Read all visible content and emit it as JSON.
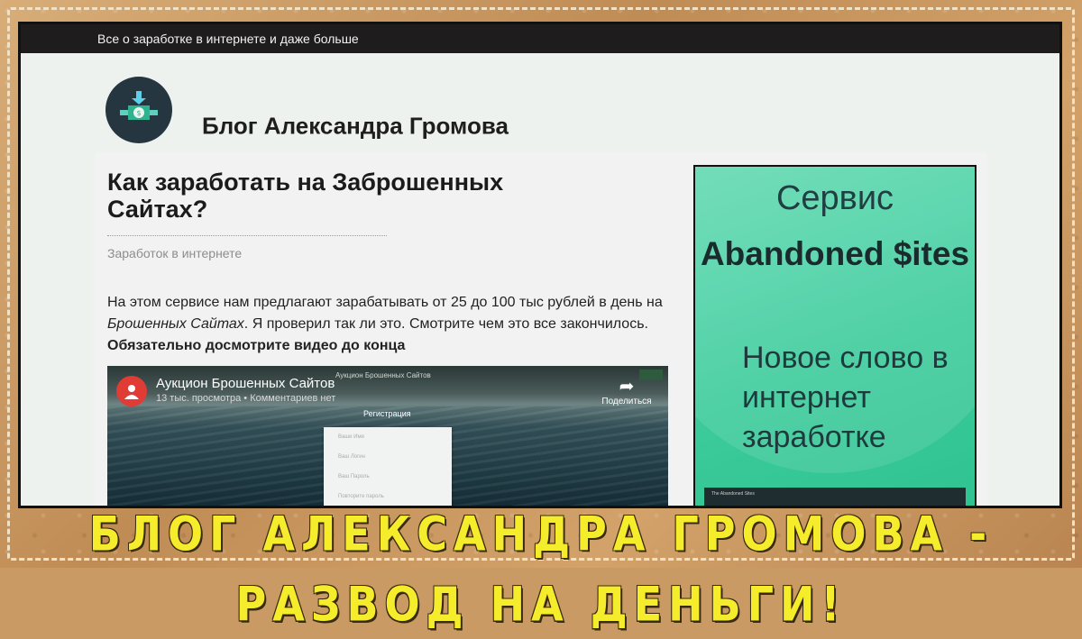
{
  "topbar": {
    "tagline": "Все о заработке в интернете и даже больше"
  },
  "header": {
    "site_title": "Блог Александра Громова",
    "logo_icon": "money-download-icon"
  },
  "article": {
    "title": "Как заработать на Заброшенных Сайтах?",
    "category": "Заработок в интернете",
    "text_part1": "На этом сервисе нам предлагают зарабатывать от 25 до 100 тыс рублей в день на ",
    "text_italic": "Брошенных Сайтах",
    "text_part2": ". Я проверил так ли это. Смотрите чем это все закончилось. ",
    "text_bold": "Обязательно досмотрите видео до конца"
  },
  "video": {
    "title": "Аукцион Брошенных Сайтов",
    "meta": "13 тыс. просмотра • Комментариев нет",
    "embedded_header": "Аукцион Брошенных Сайтов",
    "share_label": "Поделиться",
    "registration_label": "Регистрация",
    "form_fields": [
      "Ваше Имя",
      "Ваш Логин",
      "Ваш Пароль",
      "Повторите пароль"
    ]
  },
  "ad": {
    "line1": "Сервис",
    "line2": "Abandoned $ites",
    "line3": "Новое слово в интернет заработке",
    "mock_text": "The Abandoned Sites"
  },
  "banner": {
    "text": "БЛОГ АЛЕКСАНДРА ГРОМОВА - РАЗВОД НА ДЕНЬГИ!"
  },
  "colors": {
    "topbar_bg": "#1e1c1c",
    "ad_green": "#3dcb9b",
    "banner_yellow": "#f5ec2c",
    "youtube_red": "#e03b35"
  }
}
